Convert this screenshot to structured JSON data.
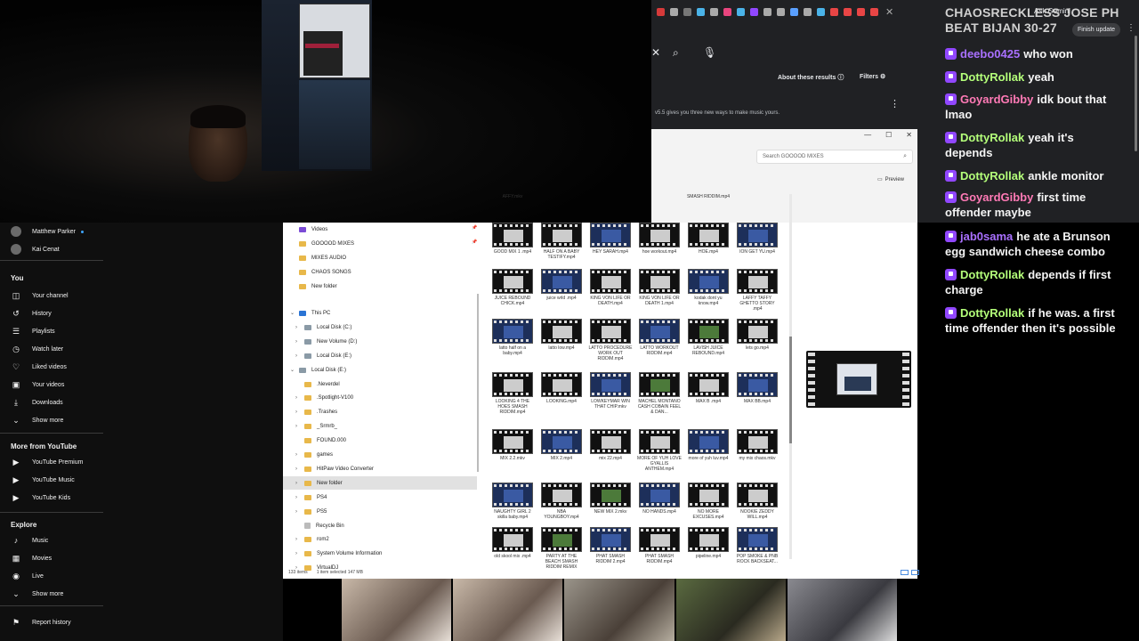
{
  "chat": {
    "header": "CHAOSRECKLESS JOSE PH BEAT BIJAN 30-27",
    "messages": [
      {
        "user": "deebo0425",
        "text": "who won",
        "color": "#a970ff"
      },
      {
        "user": "DottyRollak",
        "text": "yeah",
        "color": "#b4ff7a"
      },
      {
        "user": "GoyardGibby",
        "text": "idk bout that lmao",
        "color": "#ff7ab6"
      },
      {
        "user": "DottyRollak",
        "text": "yeah it's depends",
        "color": "#b4ff7a"
      },
      {
        "user": "DottyRollak",
        "text": "ankle monitor",
        "color": "#b4ff7a"
      },
      {
        "user": "GoyardGibby",
        "text": "first time offender maybe",
        "color": "#ff7ab6"
      },
      {
        "user": "jab0sama",
        "text": "he ate a Brunson egg sandwich cheese combo",
        "color": "#a970ff"
      },
      {
        "user": "DottyRollak",
        "text": "depends if first charge",
        "color": "#b4ff7a"
      },
      {
        "user": "DottyRollak",
        "text": "if he was. a first time offender then it's possible",
        "color": "#b4ff7a"
      }
    ]
  },
  "browser": {
    "ask_gemini": "Ask Gemini",
    "finish_update": "Finish update",
    "about_results": "About these results",
    "filters": "Filters",
    "snippet": "v5.5 gives you three new ways to make music yours."
  },
  "explorer": {
    "search_placeholder": "Search GOOOOD MIXES",
    "preview_label": "Preview",
    "status_items": "133 items",
    "status_selected": "1 item selected  147 MB",
    "nav": [
      {
        "label": "Videos",
        "kind": "vid",
        "indent": 0,
        "pin": true
      },
      {
        "label": "GOOOOD MIXES",
        "kind": "fold",
        "indent": 0,
        "pin": true
      },
      {
        "label": "MIXES AUDIO",
        "kind": "fold",
        "indent": 0
      },
      {
        "label": "CHAOS SONGS",
        "kind": "fold",
        "indent": 0
      },
      {
        "label": "New folder",
        "kind": "fold",
        "indent": 0
      },
      {
        "label": "This PC",
        "kind": "pc",
        "indent": 0,
        "chev": "down"
      },
      {
        "label": "Local Disk (C:)",
        "kind": "drive",
        "indent": 1,
        "chev": "right"
      },
      {
        "label": "New Volume (D:)",
        "kind": "drive",
        "indent": 1,
        "chev": "right"
      },
      {
        "label": "Local Disk (E:)",
        "kind": "drive",
        "indent": 1,
        "chev": "right"
      },
      {
        "label": "Local Disk (E:)",
        "kind": "drive",
        "indent": 0,
        "chev": "down"
      },
      {
        "label": ".Neverdel",
        "kind": "fold",
        "indent": 1
      },
      {
        "label": ".Spotlight-V100",
        "kind": "fold",
        "indent": 1,
        "chev": "right"
      },
      {
        "label": ".Trashes",
        "kind": "fold",
        "indent": 1,
        "chev": "right"
      },
      {
        "label": "_Srmrb_",
        "kind": "fold",
        "indent": 1,
        "chev": "right"
      },
      {
        "label": "FOUND.000",
        "kind": "fold",
        "indent": 1
      },
      {
        "label": "games",
        "kind": "fold",
        "indent": 1,
        "chev": "right"
      },
      {
        "label": "HitPaw Video Converter",
        "kind": "fold",
        "indent": 1,
        "chev": "right"
      },
      {
        "label": "New folder",
        "kind": "fold",
        "indent": 1,
        "chev": "right",
        "selected": true
      },
      {
        "label": "PS4",
        "kind": "fold",
        "indent": 1,
        "chev": "right"
      },
      {
        "label": "PS5",
        "kind": "fold",
        "indent": 1,
        "chev": "right"
      },
      {
        "label": "Recycle Bin",
        "kind": "bin",
        "indent": 1
      },
      {
        "label": "rom2",
        "kind": "fold",
        "indent": 1,
        "chev": "right"
      },
      {
        "label": "System Volume Information",
        "kind": "fold",
        "indent": 1,
        "chev": "right"
      },
      {
        "label": "VirtualDJ",
        "kind": "fold",
        "indent": 1,
        "chev": "right"
      }
    ],
    "files": [
      [
        "AFFY.mkv",
        "SMASH RIDDIM.mp4",
        ""
      ],
      [
        "GOOD MIX 1 .mp4",
        "HALF ON A BABY TESTIFY.mp4",
        "HEY SARAH.mp4",
        "hoe workout.mp4",
        "HOE.mp4",
        "ION GET YU.mp4"
      ],
      [
        "JUICE REBOUND CHICK.mp4",
        "juice wrld .mp4",
        "KING VON LIFE OR DEATH.mp4",
        "KING VON LIFE OR DEATH 1.mp4",
        "kodak dont yu know.mp4",
        "LAFFY TAFFY GHETTO STORY .mp4"
      ],
      [
        "latto half on a baby.mp4",
        "latto low.mp4",
        "LATTO PROCEDURE WORK OUT RIDDIM.mp4",
        "LATTO WORKOUT RIDDIM.mp4",
        "LAVISH JUICE REBOUND.mp4",
        "lets go.mp4"
      ],
      [
        "LOOKING 4 THE HOES SMASH RIDDIM.mp4",
        "LOOKING.mp4",
        "LOWKEYMAR WIN THAT CHIP.mkv",
        "MACHEL MONTANO CASH COBAIN FEEL & DAN...",
        "MAX B .mp4",
        "MAX BB.mp4"
      ],
      [
        "MIX 2.2.mkv",
        "MIX 2.mp4",
        "mix 22.mp4",
        "MORE OF YUH LOVE GYALLIS ANTHEM.mp4",
        "more of yuh luv.mp4",
        "my mix chaos.mkv"
      ],
      [
        "NAUGHTY GIRL 2 skilla baby.mp4",
        "NBA YOUNGBOY.mp4",
        "NEW MIX 2.mkv",
        "NO HANDS.mp4",
        "NO MORE EXCUSES.mp4",
        "NOOKIE ZEDDY WILL.mp4"
      ],
      [
        "old skool mix .mp4",
        "PARTY AT THE BEACH SMASH RIDDIM REMIX",
        "PHAT SMASH RIDDIM 2.mp4",
        "PHAT SMASH RIDDIM.mp4",
        "pipeline.mp4",
        "POP SMOKE & PNB ROCK BACKSEAT..."
      ]
    ]
  },
  "youtube": {
    "subscriptions": [
      "Matthew Parker",
      "Kai Cenat"
    ],
    "you_header": "You",
    "you_items": [
      {
        "label": "Your channel",
        "icon": "channel-icon",
        "glyph": "◫"
      },
      {
        "label": "History",
        "icon": "history-icon",
        "glyph": "↺"
      },
      {
        "label": "Playlists",
        "icon": "playlists-icon",
        "glyph": "☰"
      },
      {
        "label": "Watch later",
        "icon": "clock-icon",
        "glyph": "◷"
      },
      {
        "label": "Liked videos",
        "icon": "thumbs-up-icon",
        "glyph": "♡"
      },
      {
        "label": "Your videos",
        "icon": "video-icon",
        "glyph": "▣"
      },
      {
        "label": "Downloads",
        "icon": "download-icon",
        "glyph": "⤓"
      },
      {
        "label": "Show more",
        "icon": "chevron-down-icon",
        "glyph": "⌄"
      }
    ],
    "more_header": "More from YouTube",
    "more_items": [
      "YouTube Premium",
      "YouTube Music",
      "YouTube Kids"
    ],
    "explore_header": "Explore",
    "explore_items": [
      {
        "label": "Music",
        "icon": "music-icon",
        "glyph": "♪"
      },
      {
        "label": "Movies",
        "icon": "movies-icon",
        "glyph": "▦"
      },
      {
        "label": "Live",
        "icon": "live-icon",
        "glyph": "◉"
      },
      {
        "label": "Show more",
        "icon": "chevron-down-icon",
        "glyph": "⌄"
      }
    ],
    "report": "Report history"
  },
  "colors": {
    "twitch_purple": "#9147ff",
    "yt_red": "#ff0033"
  }
}
